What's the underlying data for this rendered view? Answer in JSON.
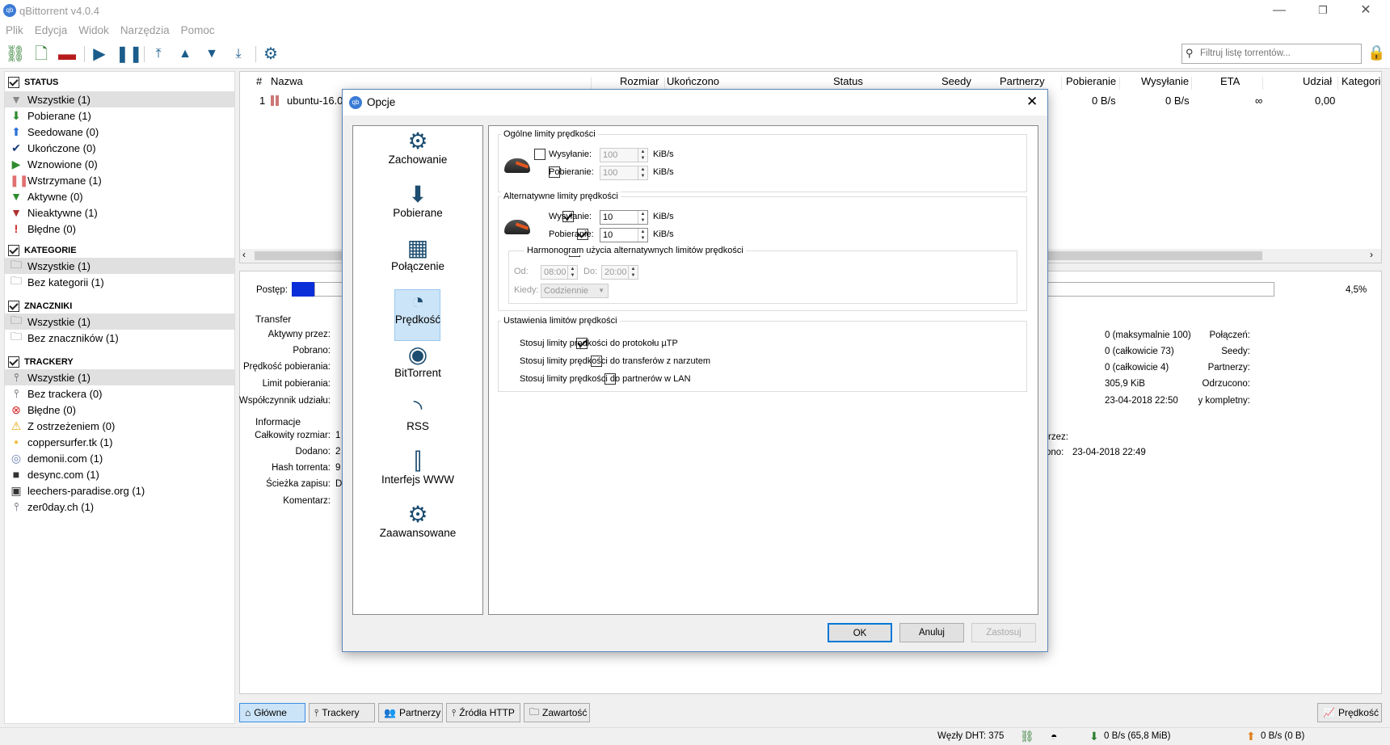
{
  "window": {
    "title": "qBittorrent v4.0.4",
    "app_icon": "qb"
  },
  "menu": [
    "Plik",
    "Edycja",
    "Widok",
    "Narzędzia",
    "Pomoc"
  ],
  "search": {
    "placeholder": "Filtruj listę torrentów..."
  },
  "sidebar": {
    "status": {
      "title": "STATUS",
      "items": [
        {
          "label": "Wszystkie (1)",
          "icon": "filter-icon",
          "color": "#888888"
        },
        {
          "label": "Pobierane (1)",
          "icon": "download-arrow-icon",
          "color": "#2e8b2e"
        },
        {
          "label": "Seedowane (0)",
          "icon": "upload-arrow-icon",
          "color": "#2a6fd6"
        },
        {
          "label": "Ukończone (0)",
          "icon": "checkmark-icon",
          "color": "#1a3a7a"
        },
        {
          "label": "Wznowione (0)",
          "icon": "play-icon",
          "color": "#2e8b2e"
        },
        {
          "label": "Wstrzymane (1)",
          "icon": "pause-icon",
          "color": "#e07070"
        },
        {
          "label": "Aktywne (0)",
          "icon": "filter-green-icon",
          "color": "#2e8b2e"
        },
        {
          "label": "Nieaktywne (1)",
          "icon": "filter-red-icon",
          "color": "#b03030"
        },
        {
          "label": "Błędne (0)",
          "icon": "exclamation-icon",
          "color": "#d02020"
        }
      ]
    },
    "categories": {
      "title": "KATEGORIE",
      "items": [
        {
          "label": "Wszystkie (1)"
        },
        {
          "label": "Bez kategorii (1)"
        }
      ]
    },
    "tags": {
      "title": "ZNACZNIKI",
      "items": [
        {
          "label": "Wszystkie (1)"
        },
        {
          "label": "Bez znaczników (1)"
        }
      ]
    },
    "trackers": {
      "title": "TRACKERY",
      "items": [
        {
          "label": "Wszystkie (1)",
          "icon": "tracker-icon"
        },
        {
          "label": "Bez trackera (0)",
          "icon": "tracker-icon"
        },
        {
          "label": "Błędne (0)",
          "icon": "error-circle-icon"
        },
        {
          "label": "Z ostrzeżeniem (0)",
          "icon": "warning-icon"
        },
        {
          "label": "coppersurfer.tk (1)",
          "icon": "favicon-icon"
        },
        {
          "label": "demonii.com (1)",
          "icon": "favicon-icon"
        },
        {
          "label": "desync.com (1)",
          "icon": "favicon-icon"
        },
        {
          "label": "leechers-paradise.org (1)",
          "icon": "favicon-icon"
        },
        {
          "label": "zer0day.ch (1)",
          "icon": "tracker-icon"
        }
      ]
    }
  },
  "torrent_list": {
    "columns": [
      "#",
      "Nazwa",
      "Rozmiar",
      "Ukończono",
      "Status",
      "Seedy",
      "Partnerzy",
      "Pobieranie",
      "Wysyłanie",
      "ETA",
      "Udział",
      "Kategori"
    ],
    "rows": [
      {
        "num": "1",
        "name": "ubuntu-16.0",
        "dl": "0 B/s",
        "ul": "0 B/s",
        "eta": "∞",
        "ratio": "0,00"
      }
    ]
  },
  "details": {
    "progress_label": "Postęp:",
    "progress_value": "4,5%",
    "transfer_title": "Transfer",
    "transfer_left": [
      "Aktywny przez:",
      "Pobrano:",
      "Prędkość pobierania:",
      "Limit pobierania:",
      "Współczynnik udziału:"
    ],
    "transfer_right": [
      {
        "label": "Połączeń:",
        "value": "0 (maksymalnie 100)"
      },
      {
        "label": "Seedy:",
        "value": "0 (całkowicie 73)"
      },
      {
        "label": "Partnerzy:",
        "value": "0 (całkowicie 4)"
      },
      {
        "label": "Odrzucono:",
        "value": "305,9 KiB"
      },
      {
        "label": "y kompletny:",
        "value": "23-04-2018 22:50"
      }
    ],
    "info_title": "Informacje",
    "info_left": [
      {
        "label": "Całkowity rozmiar:",
        "value": "1"
      },
      {
        "label": "Dodano:",
        "value": "2"
      },
      {
        "label": "Hash torrenta:",
        "value": "9"
      },
      {
        "label": "Ścieżka zapisu:",
        "value": "D"
      },
      {
        "label": "Komentarz:",
        "value": ""
      }
    ],
    "info_right": [
      {
        "label": "rzez:",
        "value": ""
      },
      {
        "label": "ono:",
        "value": "23-04-2018 22:49"
      }
    ]
  },
  "bottom_tabs": [
    "Główne",
    "Trackery",
    "Partnerzy",
    "Źródła HTTP",
    "Zawartość"
  ],
  "speed_button": "Prędkość",
  "statusbar": {
    "dht": "Węzły DHT: 375",
    "download": "0 B/s (65,8 MiB)",
    "upload": "0 B/s (0 B)"
  },
  "dialog": {
    "title": "Opcje",
    "categories": [
      {
        "label": "Zachowanie",
        "icon": "monitor-gear-icon",
        "glyph": "⚙"
      },
      {
        "label": "Pobierane",
        "icon": "download-tray-icon",
        "glyph": "⬇"
      },
      {
        "label": "Połączenie",
        "icon": "network-port-icon",
        "glyph": "▦"
      },
      {
        "label": "Prędkość",
        "icon": "speedometer-icon",
        "glyph": "◔"
      },
      {
        "label": "BitTorrent",
        "icon": "globe-gear-icon",
        "glyph": "◉"
      },
      {
        "label": "RSS",
        "icon": "rss-icon",
        "glyph": "◝"
      },
      {
        "label": "Interfejs WWW",
        "icon": "web-ui-icon",
        "glyph": "⫿"
      },
      {
        "label": "Zaawansowane",
        "icon": "gears-icon",
        "glyph": "⚙"
      }
    ],
    "selected_category": "Prędkość",
    "global": {
      "title": "Ogólne limity prędkości",
      "upload_label": "Wysyłanie:",
      "upload_value": "100",
      "upload_checked": false,
      "download_label": "Pobieranie:",
      "download_value": "100",
      "download_checked": false,
      "unit": "KiB/s"
    },
    "alternative": {
      "title": "Alternatywne limity prędkości",
      "upload_label": "Wysyłanie:",
      "upload_value": "10",
      "upload_checked": true,
      "download_label": "Pobieranie:",
      "download_value": "10",
      "download_checked": true,
      "unit": "KiB/s",
      "schedule_label": "Harmonogram użycia alternatywnych limitów prędkości",
      "schedule_checked": false,
      "from_label": "Od:",
      "from_value": "08:00",
      "to_label": "Do:",
      "to_value": "20:00",
      "when_label": "Kiedy:",
      "when_value": "Codziennie"
    },
    "settings": {
      "title": "Ustawienia limitów prędkości",
      "items": [
        {
          "label": "Stosuj limity prędkości do protokołu µTP",
          "checked": true
        },
        {
          "label": "Stosuj limity prędkości do transferów z narzutem",
          "checked": false
        },
        {
          "label": "Stosuj limity prędkości do partnerów w LAN",
          "checked": false
        }
      ]
    },
    "buttons": {
      "ok": "OK",
      "cancel": "Anuluj",
      "apply": "Zastosuj"
    }
  }
}
